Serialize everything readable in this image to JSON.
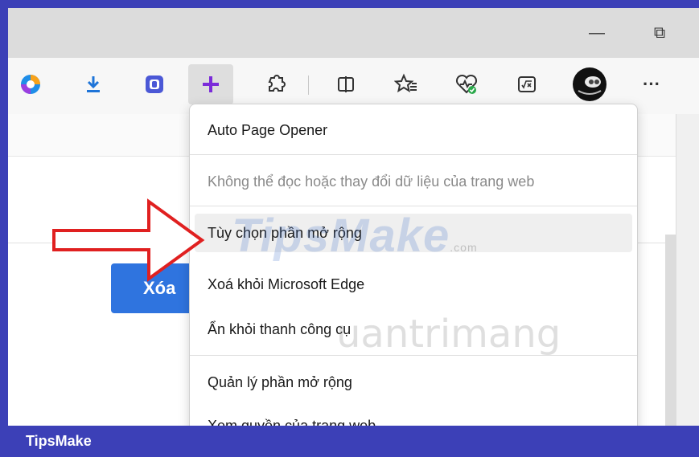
{
  "window": {
    "minimize_glyph": "—",
    "restore_glyph": "⧉"
  },
  "toolbar": {
    "icons": [
      "copilot-icon",
      "download-icon",
      "password-manager-icon",
      "add-extension-icon",
      "extensions-icon",
      "split-screen-icon",
      "favorites-icon",
      "browser-essentials-icon",
      "math-solver-icon",
      "profile-avatar-icon",
      "more-options-icon"
    ],
    "more_glyph": "···"
  },
  "menu": {
    "items": [
      {
        "label": "Auto Page Opener"
      },
      {
        "label": "Không thể đọc hoặc thay đổi dữ liệu của trang web"
      },
      {
        "label": "Tùy chọn phần mở rộng"
      },
      {
        "label": "Xoá khỏi Microsoft Edge"
      },
      {
        "label": "Ẩn khỏi thanh công cụ"
      },
      {
        "label": "Quản lý phần mở rộng"
      },
      {
        "label": "Xem quyền của trang web"
      }
    ]
  },
  "page": {
    "button_label": "Xóa"
  },
  "watermark": {
    "brand": "TipsMake",
    "suffix": ".com",
    "second": "uantrimang"
  },
  "footer": {
    "label": "TipsMake"
  },
  "colors": {
    "frame": "#3c40b7",
    "accent_purple": "#7b2bd9",
    "button_blue": "#2f74df"
  }
}
